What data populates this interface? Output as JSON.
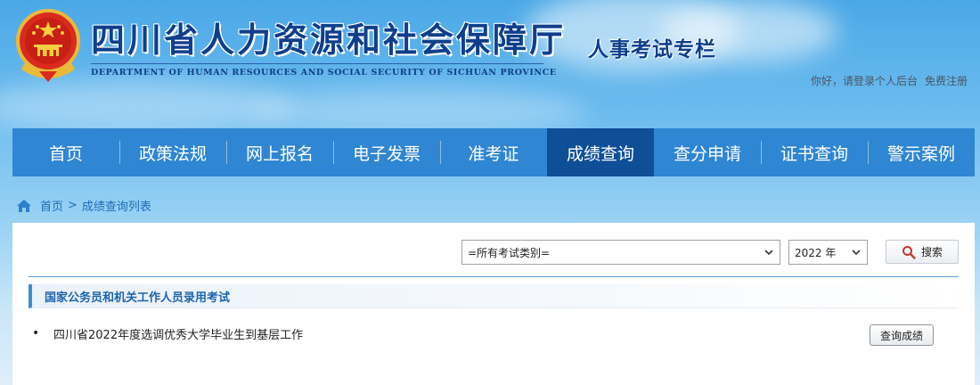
{
  "header": {
    "site_title": "四川省人力资源和社会保障厅",
    "site_subtitle": "DEPARTMENT OF HUMAN RESOURCES AND SOCIAL SECURITY OF SICHUAN PROVINCE",
    "section_title": "人事考试专栏",
    "login_link": "你好，请登录个人后台",
    "register_link": "免费注册",
    "emblem_icon": "national-emblem-icon"
  },
  "nav": {
    "items": [
      {
        "label": "首页",
        "active": false
      },
      {
        "label": "政策法规",
        "active": false
      },
      {
        "label": "网上报名",
        "active": false
      },
      {
        "label": "电子发票",
        "active": false
      },
      {
        "label": "准考证",
        "active": false
      },
      {
        "label": "成绩查询",
        "active": true
      },
      {
        "label": "查分申请",
        "active": false
      },
      {
        "label": "证书查询",
        "active": false
      },
      {
        "label": "警示案例",
        "active": false
      }
    ],
    "active_color": "#0f4f98",
    "bar_color": "#2f86d2"
  },
  "breadcrumb": {
    "home": "首页",
    "separator": ">",
    "current": "成绩查询列表"
  },
  "filters": {
    "exam_category": "=所有考试类别=",
    "year": "2022 年",
    "search_label": "搜索"
  },
  "results": {
    "category_title": "国家公务员和机关工作人员录用考试",
    "items": [
      {
        "title": "四川省2022年度选调优秀大学毕业生到基层工作",
        "action_label": "查询成绩"
      }
    ]
  }
}
